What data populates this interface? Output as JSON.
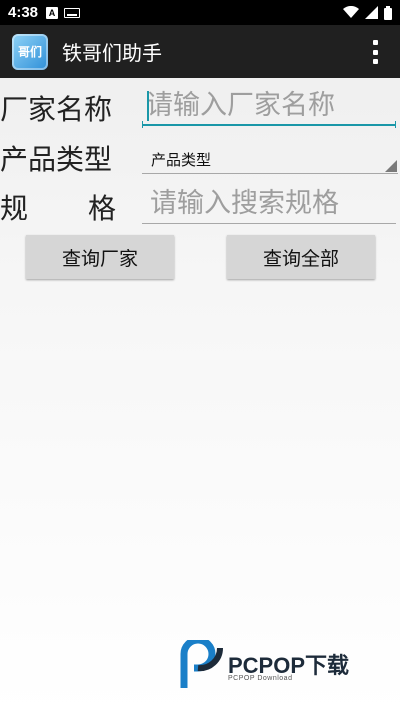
{
  "status_bar": {
    "time": "4:38",
    "notification_icons": [
      "a-notification-icon",
      "keyboard-icon"
    ],
    "system_icons": [
      "wifi-icon",
      "signal-icon",
      "battery-icon"
    ]
  },
  "action_bar": {
    "app_icon_text": "哥们",
    "title": "铁哥们助手",
    "menu_icon": "overflow-menu-icon"
  },
  "form": {
    "factory_name": {
      "label": "厂家名称",
      "value": "",
      "placeholder": "请输入厂家名称"
    },
    "product_type": {
      "label": "产品类型",
      "selected": "产品类型"
    },
    "spec": {
      "label_left": "规",
      "label_right": "格",
      "value": "",
      "placeholder": "请输入搜索规格"
    }
  },
  "buttons": {
    "query_factory": "查询厂家",
    "query_all": "查询全部"
  },
  "watermark": {
    "brand": "PCPOP下载",
    "subtitle": "PCPOP Download"
  },
  "colors": {
    "accent": "#1a97a8",
    "action_bar": "#202020",
    "button": "#d6d6d6"
  }
}
